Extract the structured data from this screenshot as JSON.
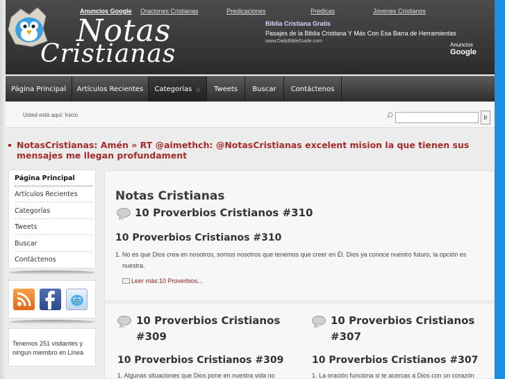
{
  "ad_topbar": {
    "ads_label": "Anuncios Google",
    "links": [
      "Oraciones Cristianas",
      "Predicaciones",
      "Predicas",
      "Jovenes Cristianos"
    ]
  },
  "logo": {
    "line1": "Notas",
    "line2": "Cristianas"
  },
  "ad": {
    "title": "Biblia Cristiana Gratis",
    "description": "Pasajes de la Biblia Cristiana Y Más Con Esa Barra de Herramientas",
    "url": "www.DailyBibleGuide.com",
    "label_small": "Anuncios",
    "label_brand": "Google"
  },
  "nav": {
    "items": [
      "Página Principal",
      "Artículos Recientes",
      "Categorías",
      "Tweets",
      "Buscar",
      "Contáctenos"
    ],
    "dropdown_arrow": "◇"
  },
  "breadcrumb": {
    "text": "Usted está aquí:  Inicio"
  },
  "search": {
    "value": "",
    "button_label": "Ir"
  },
  "tweet": {
    "text": "NotasCristianas: Amén » RT @aimethch: @NotasCristianas excelent mision la que tienen sus mensajes me llegan profundament"
  },
  "sidebar": {
    "items": [
      "Página Principal",
      "Artículos Recientes",
      "Categorías",
      "Tweets",
      "Buscar",
      "Contáctenos"
    ],
    "social": [
      "rss-icon",
      "facebook-icon",
      "twitter-icon"
    ],
    "visitors_text": "Tenemos 251 visitantes y ningun miembro en Línea"
  },
  "main": {
    "site_title": "Notas Cristianas",
    "featured_heading": "10 Proverbios Cristianos #310",
    "featured_title": "10 Proverbios Cristianos #310",
    "featured_num": "1.",
    "featured_text": "No es que Dios crea en nosotros, somos nosotros que tenemos que creer en Él. Dios ya conoce nuestro futuro, la opción es nuestra.",
    "read_more": "Leer más:10 Proverbios...",
    "articles": [
      {
        "heading": "10 Proverbios Cristianos #309",
        "title": "10 Proverbios Cristianos #309",
        "excerpt": "1.   Algunas situaciones que Dios pone en nuestra vida no"
      },
      {
        "heading": "10 Proverbios Cristianos #307",
        "title": "10 Proverbios Cristianos #307",
        "excerpt": "1.   La oración funciona si te acercas a Dios con un corazón"
      }
    ]
  },
  "colors": {
    "accent_red": "#a52a2a",
    "header_dark": "#3a3a3a",
    "right_strip": "#1f8de0"
  }
}
